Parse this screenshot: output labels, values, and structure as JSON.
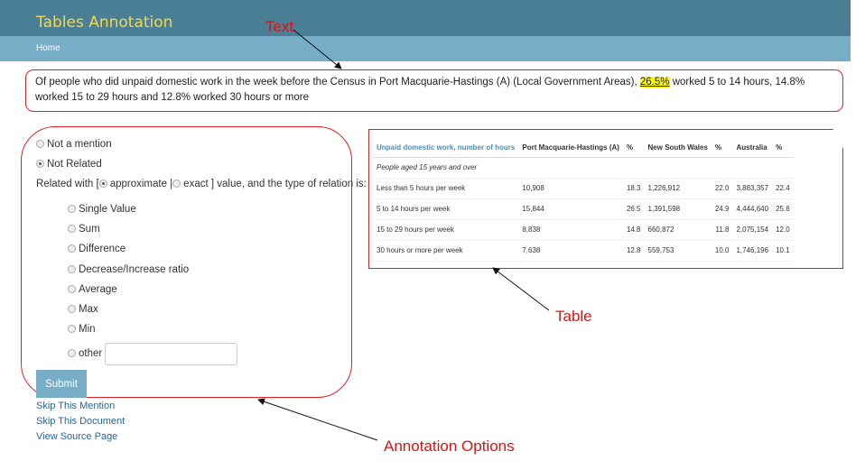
{
  "app": {
    "title": "Tables Annotation",
    "nav_home": "Home"
  },
  "annotations": {
    "text_label": "Text",
    "table_label": "Table",
    "options_label": "Annotation Options"
  },
  "mention": {
    "before": "Of people who did unpaid domestic work in the week before the Census in Port Macquarie-Hastings (A) (Local Government Areas), ",
    "highlight": "26.5%",
    "after": " worked 5 to 14 hours, 14.8% worked 15 to 29 hours and 12.8% worked 30 hours or more"
  },
  "form": {
    "not_a_mention": "Not a mention",
    "not_related": "Not Related",
    "related_prefix": "Related with [",
    "approximate": "approximate",
    "exact": "exact",
    "related_suffix": "] value, and the type of relation is:",
    "relations": [
      {
        "label": "Single Value"
      },
      {
        "label": "Sum"
      },
      {
        "label": "Difference"
      },
      {
        "label": "Decrease/Increase ratio"
      },
      {
        "label": "Average"
      },
      {
        "label": "Max"
      },
      {
        "label": "Min"
      }
    ],
    "other_label": "other",
    "other_value": "",
    "selected": {
      "not_related": true,
      "approximate": true
    },
    "submit": "Submit",
    "links": [
      "Skip This Mention",
      "Skip This Document",
      "View Source Page"
    ]
  },
  "table": {
    "headers": [
      "Unpaid domestic work, number of hours",
      "Port Macquarie-Hastings (A)",
      "%",
      "New South Wales",
      "%",
      "Australia",
      "%"
    ],
    "subheader": "People aged 15 years and over",
    "rows": [
      [
        "Less than 5 hours per week",
        "10,908",
        "18.3",
        "1,226,912",
        "22.0",
        "3,883,357",
        "22.4"
      ],
      [
        "5 to 14 hours per week",
        "15,844",
        "26.5",
        "1,391,598",
        "24.9",
        "4,444,640",
        "25.6"
      ],
      [
        "15 to 29 hours per week",
        "8,838",
        "14.8",
        "660,872",
        "11.8",
        "2,075,154",
        "12.0"
      ],
      [
        "30 hours or more per week",
        "7,638",
        "12.8",
        "559,753",
        "10.0",
        "1,746,196",
        "10.1"
      ]
    ]
  }
}
